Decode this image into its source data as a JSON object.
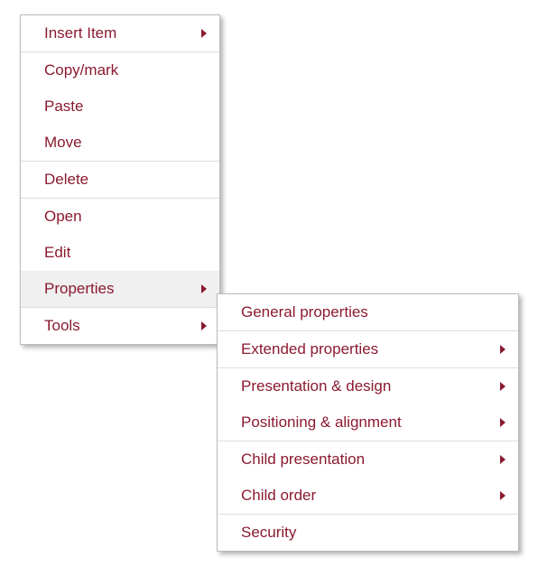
{
  "accent_color": "#8a1a2f",
  "main_menu": {
    "items": [
      {
        "label": "Insert Item",
        "has_submenu": true
      },
      {
        "label": "Copy/mark",
        "has_submenu": false
      },
      {
        "label": "Paste",
        "has_submenu": false
      },
      {
        "label": "Move",
        "has_submenu": false
      },
      {
        "label": "Delete",
        "has_submenu": false
      },
      {
        "label": "Open",
        "has_submenu": false
      },
      {
        "label": "Edit",
        "has_submenu": false
      },
      {
        "label": "Properties",
        "has_submenu": true,
        "hovered": true
      },
      {
        "label": "Tools",
        "has_submenu": true
      }
    ]
  },
  "sub_menu": {
    "items": [
      {
        "label": "General properties",
        "has_submenu": false
      },
      {
        "label": "Extended properties",
        "has_submenu": true
      },
      {
        "label": "Presentation & design",
        "has_submenu": true
      },
      {
        "label": "Positioning & alignment",
        "has_submenu": true
      },
      {
        "label": "Child presentation",
        "has_submenu": true
      },
      {
        "label": "Child order",
        "has_submenu": true
      },
      {
        "label": "Security",
        "has_submenu": false
      }
    ]
  }
}
